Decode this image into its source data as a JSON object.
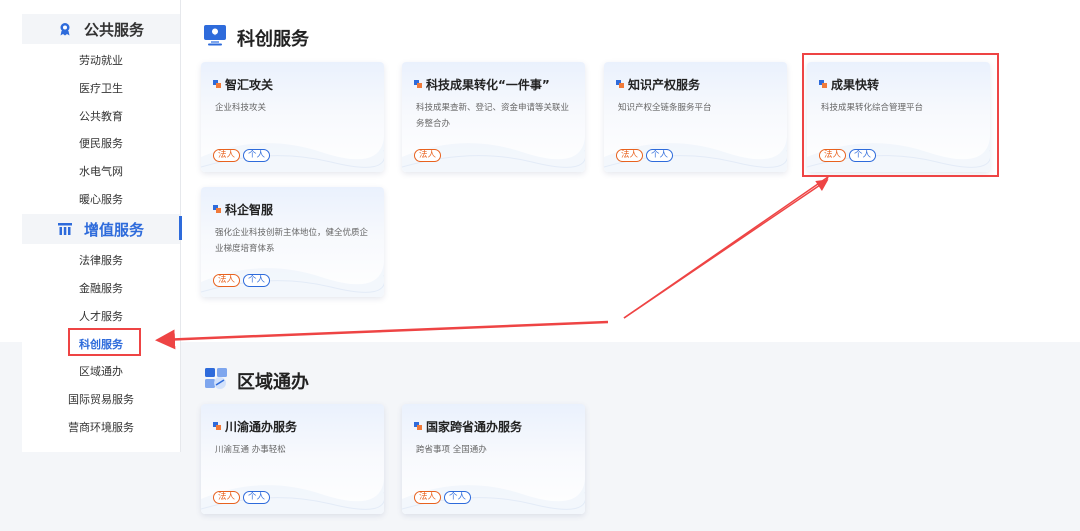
{
  "sidebar": {
    "groups": [
      {
        "label": "公共服务",
        "items": [
          "劳动就业",
          "医疗卫生",
          "公共教育",
          "便民服务",
          "水电气网",
          "暖心服务"
        ]
      },
      {
        "label": "增值服务",
        "items": [
          "法律服务",
          "金融服务",
          "人才服务",
          "科创服务",
          "区域通办",
          "国际贸易服务",
          "营商环境服务"
        ]
      }
    ],
    "active_group": "增值服务",
    "current_item": "科创服务"
  },
  "sections": [
    {
      "title": "科创服务",
      "icon": "monitor-icon",
      "cards": [
        {
          "title": "智汇攻关",
          "desc": "企业科技攻关",
          "tags": [
            "法人",
            "个人"
          ]
        },
        {
          "title": "科技成果转化“一件事”",
          "desc": "科技成果查新、登记、资金申请等关联业务整合办",
          "tags": [
            "法人"
          ]
        },
        {
          "title": "知识产权服务",
          "desc": "知识产权全链条服务平台",
          "tags": [
            "法人",
            "个人"
          ]
        },
        {
          "title": "成果快转",
          "desc": "科技成果转化综合管理平台",
          "tags": [
            "法人",
            "个人"
          ]
        },
        {
          "title": "科企智服",
          "desc": "强化企业科技创新主体地位，健全优质企业梯度培育体系",
          "tags": [
            "法人",
            "个人"
          ]
        }
      ]
    },
    {
      "title": "区域通办",
      "icon": "region-icon",
      "cards": [
        {
          "title": "川渝通办服务",
          "desc": "川渝互通 办事轻松",
          "tags": [
            "法人",
            "个人"
          ]
        },
        {
          "title": "国家跨省通办服务",
          "desc": "跨省事项 全国通办",
          "tags": [
            "法人",
            "个人"
          ]
        }
      ]
    }
  ],
  "colors": {
    "accent": "#2e6bdb",
    "corporate_tag": "#e8621f",
    "highlight": "#ee4444"
  }
}
